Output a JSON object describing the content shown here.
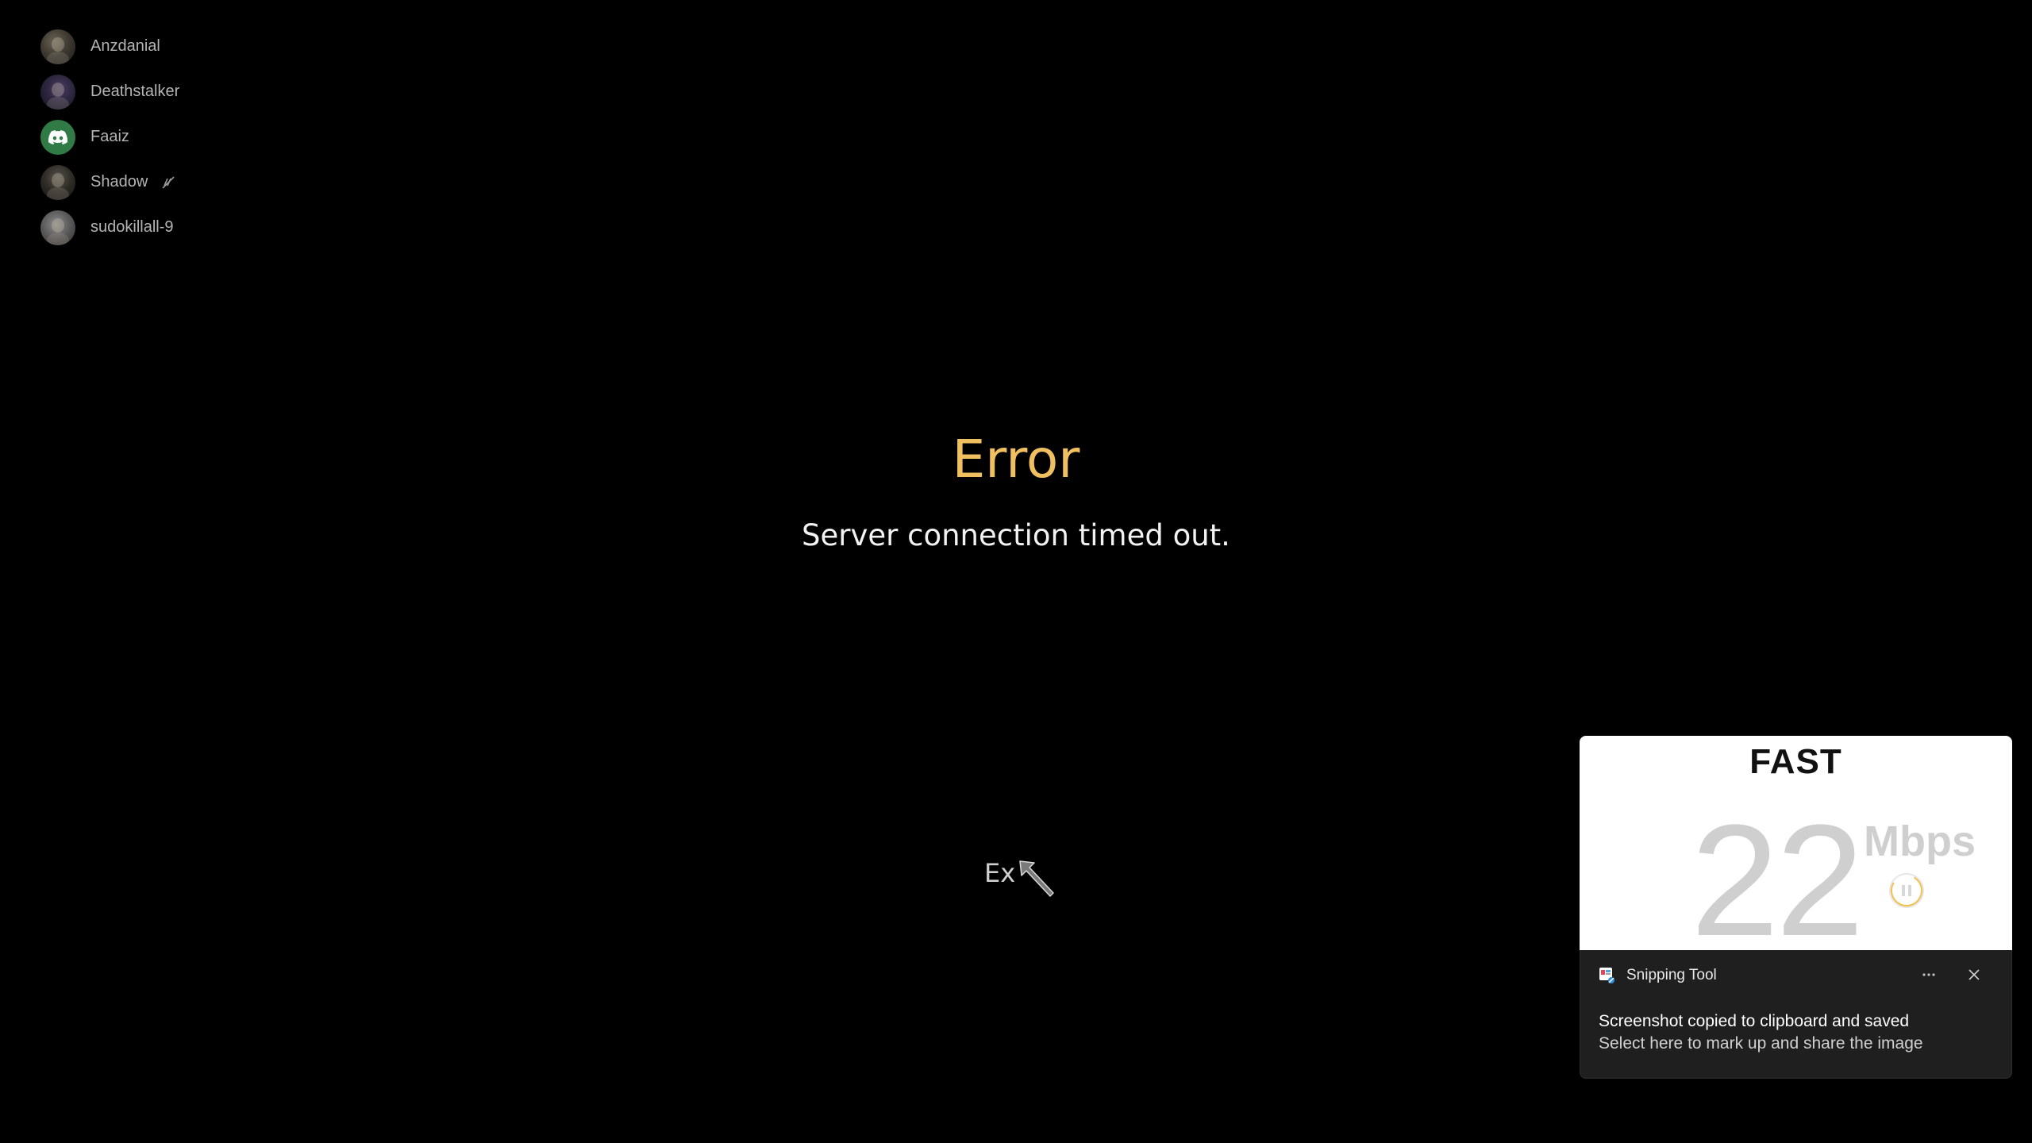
{
  "voice_overlay": {
    "users": [
      {
        "name": "Anzdanial",
        "avatar": "user-avatar-photo"
      },
      {
        "name": "Deathstalker",
        "avatar": "user-avatar-photo"
      },
      {
        "name": "Faaiz",
        "avatar": "discord-default-avatar-icon"
      },
      {
        "name": "Shadow",
        "avatar": "user-avatar-photo",
        "status_icon": "deafened-icon"
      },
      {
        "name": "sudokillall-9",
        "avatar": "user-avatar-photo"
      }
    ]
  },
  "error_dialog": {
    "title": "Error",
    "message": "Server connection timed out.",
    "exit_label": "Ex",
    "title_color": "#f0c060"
  },
  "speed_widget": {
    "brand": "FAST",
    "value": "22",
    "unit": "Mbps",
    "control_icon": "pause-icon",
    "accent_color": "#f2c14e"
  },
  "notification": {
    "app_name": "Snipping Tool",
    "app_icon": "snipping-tool-icon",
    "more_icon": "more-options-icon",
    "close_icon": "close-icon",
    "title": "Screenshot copied to clipboard and saved",
    "subtitle": "Select here to mark up and share the image"
  }
}
